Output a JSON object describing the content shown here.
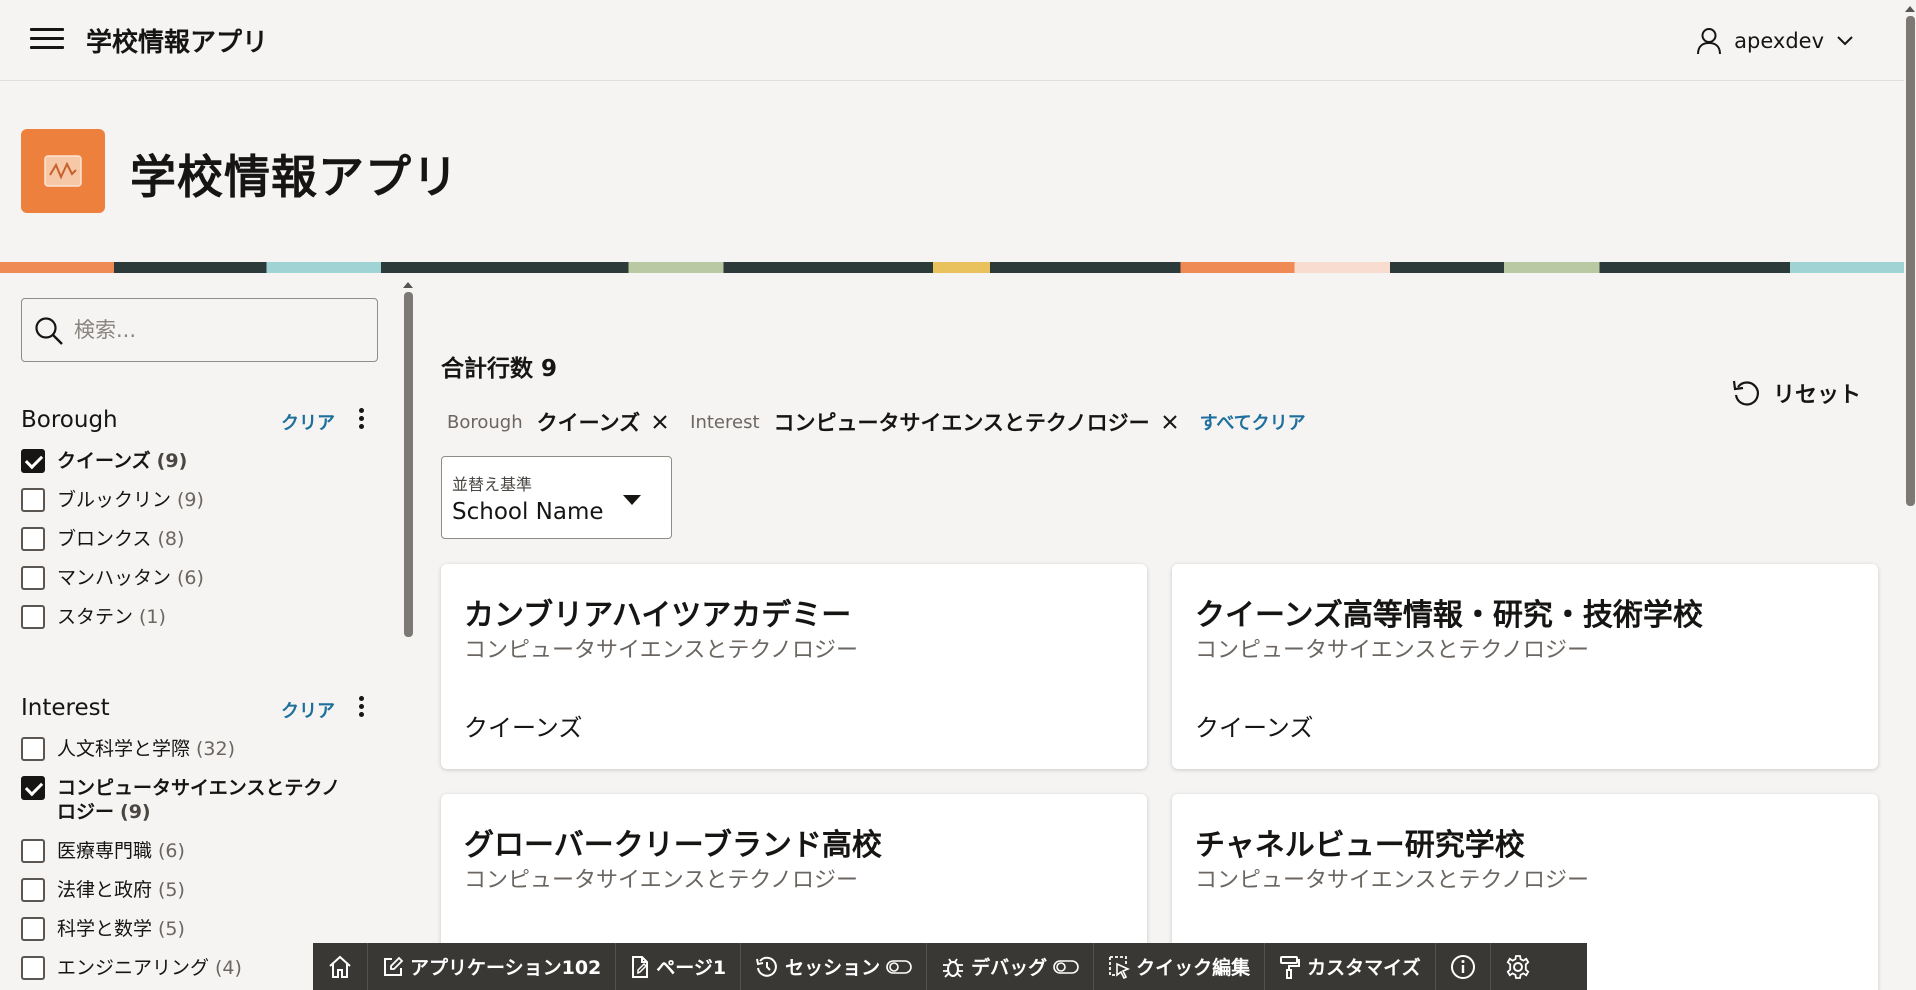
{
  "header": {
    "app_title": "学校情報アプリ",
    "user_name": "apexdev"
  },
  "hero": {
    "title": "学校情報アプリ"
  },
  "search": {
    "placeholder": "検索...",
    "value": ""
  },
  "facets": {
    "borough": {
      "title": "Borough",
      "clear_label": "クリア",
      "items": [
        {
          "label": "クイーンズ",
          "count": "(9)",
          "checked": true
        },
        {
          "label": "ブルックリン",
          "count": "(9)",
          "checked": false
        },
        {
          "label": "ブロンクス",
          "count": "(8)",
          "checked": false
        },
        {
          "label": "マンハッタン",
          "count": "(6)",
          "checked": false
        },
        {
          "label": "スタテン",
          "count": "(1)",
          "checked": false
        }
      ]
    },
    "interest": {
      "title": "Interest",
      "clear_label": "クリア",
      "items": [
        {
          "label": "人文科学と学際",
          "count": "(32)",
          "checked": false
        },
        {
          "label": "コンピュータサイエンスとテクノロジー",
          "count": "(9)",
          "checked": true
        },
        {
          "label": "医療専門職",
          "count": "(6)",
          "checked": false
        },
        {
          "label": "法律と政府",
          "count": "(5)",
          "checked": false
        },
        {
          "label": "科学と数学",
          "count": "(5)",
          "checked": false
        },
        {
          "label": "エンジニアリング",
          "count": "(4)",
          "checked": false
        }
      ]
    }
  },
  "results": {
    "total_label": "合計行数 9",
    "reset_label": "リセット",
    "chips": [
      {
        "facet": "Borough",
        "value": "クイーンズ"
      },
      {
        "facet": "Interest",
        "value": "コンピュータサイエンスとテクノロジー"
      }
    ],
    "clear_all_label": "すべてクリア",
    "sort": {
      "label": "並替え基準",
      "value": "School Name"
    },
    "cards": [
      {
        "title": "カンブリアハイツアカデミー",
        "subtitle": "コンピュータサイエンスとテクノロジー",
        "borough": "クイーンズ"
      },
      {
        "title": "クイーンズ高等情報・研究・技術学校",
        "subtitle": "コンピュータサイエンスとテクノロジー",
        "borough": "クイーンズ"
      },
      {
        "title": "グローバークリーブランド高校",
        "subtitle": "コンピュータサイエンスとテクノロジー",
        "borough": ""
      },
      {
        "title": "チャネルビュー研究学校",
        "subtitle": "コンピュータサイエンスとテクノロジー",
        "borough": ""
      }
    ]
  },
  "devbar": {
    "home_icon": "home-icon",
    "application_label": "アプリケーション102",
    "page_label": "ページ1",
    "session_label": "セッション",
    "debug_label": "デバッグ",
    "quick_edit_label": "クイック編集",
    "customize_label": "カスタマイズ",
    "info_icon": "info-icon",
    "settings_icon": "gear-icon"
  },
  "colors": {
    "accent": "#ee803d",
    "link": "#1e6f9e",
    "background": "#f5f4f2",
    "devbar": "#3a3835"
  }
}
